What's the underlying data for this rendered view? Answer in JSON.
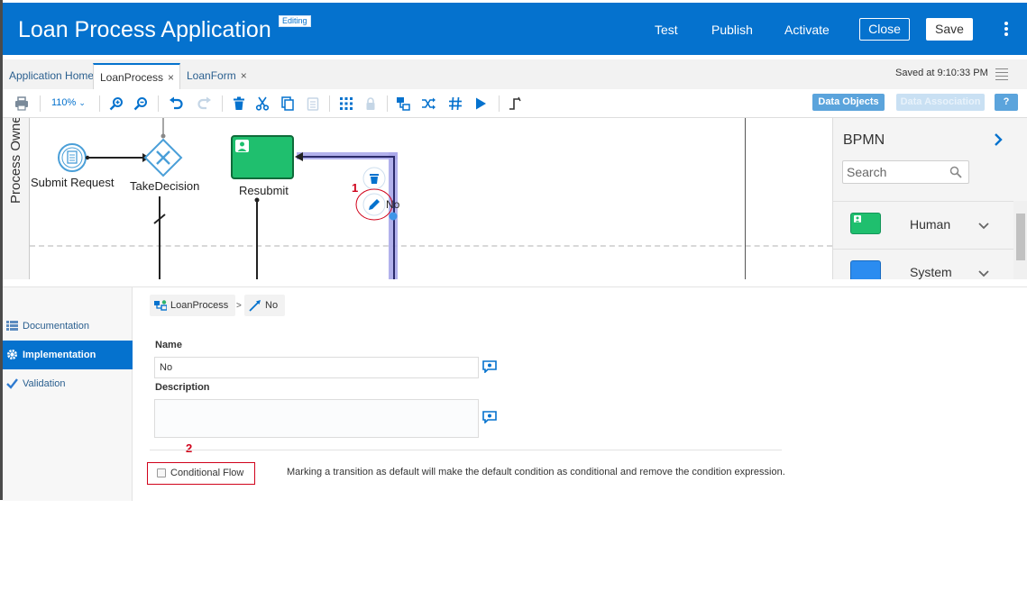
{
  "header": {
    "title": "Loan Process Application",
    "badge": "Editing",
    "actions": {
      "test": "Test",
      "publish": "Publish",
      "activate": "Activate",
      "close": "Close",
      "save": "Save"
    }
  },
  "tabs": [
    {
      "label": "Application Home",
      "closable": false,
      "active": false
    },
    {
      "label": "LoanProcess",
      "closable": true,
      "active": true
    },
    {
      "label": "LoanForm",
      "closable": true,
      "active": false
    }
  ],
  "close_glyph": "×",
  "saved_status": "Saved at 9:10:33 PM",
  "toolbar": {
    "zoom": "110%",
    "data_objects": "Data Objects",
    "data_association": "Data Association",
    "help": "?"
  },
  "canvas": {
    "lane_label": "Process Owne",
    "nodes": {
      "submit_request": "Submit Request",
      "take_decision": "TakeDecision",
      "resubmit": "Resubmit",
      "no_flow": "No"
    },
    "annotation_1": "1",
    "annotation_2": "2"
  },
  "palette": {
    "title": "BPMN",
    "search_placeholder": "Search",
    "items": [
      {
        "label": "Human",
        "color": "#1fbf6e"
      },
      {
        "label": "System",
        "color": "#2b8cf0"
      }
    ]
  },
  "properties": {
    "nav": [
      {
        "label": "Documentation",
        "active": false
      },
      {
        "label": "Implementation",
        "active": true
      },
      {
        "label": "Validation",
        "active": false
      }
    ],
    "breadcrumb": {
      "process": "LoanProcess",
      "separator": ">",
      "element": "No"
    },
    "name_label": "Name",
    "name_value": "No",
    "description_label": "Description",
    "description_value": "",
    "conditional_flow_label": "Conditional Flow",
    "hint": "Marking a transition as default will make the default condition as conditional and remove the condition expression."
  },
  "colors": {
    "brand": "#0572ce",
    "annotation": "#d0021b",
    "selection": "#7b7bdc"
  }
}
